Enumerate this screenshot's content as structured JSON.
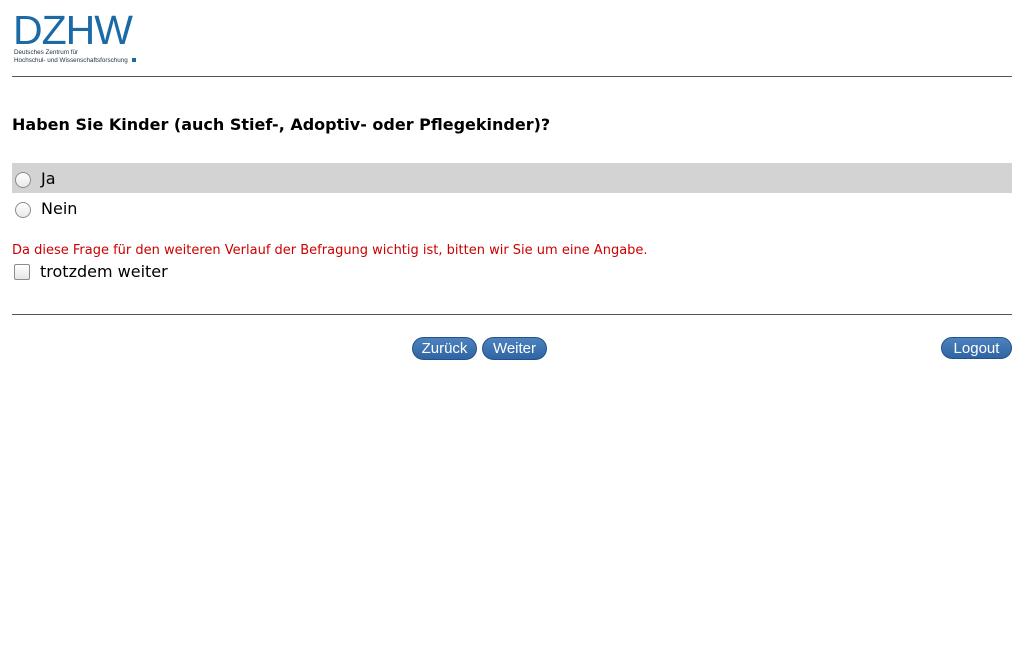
{
  "logo": {
    "mark": "DZHW",
    "line1": "Deutsches Zentrum für",
    "line2": "Hochschul- und Wissenschaftsforschung"
  },
  "question": "Haben Sie Kinder (auch Stief-, Adoptiv- oder Pflegekinder)?",
  "options": [
    {
      "label": "Ja",
      "selected": false
    },
    {
      "label": "Nein",
      "selected": false
    }
  ],
  "validation_message": "Da diese Frage für den weiteren Verlauf der Befragung wichtig ist, bitten wir Sie um eine Angabe.",
  "override_checkbox": {
    "label": "trotzdem weiter",
    "checked": false
  },
  "buttons": {
    "back": "Zurück",
    "next": "Weiter",
    "logout": "Logout"
  },
  "colors": {
    "accent": "#2f65a3",
    "error": "#cc0000",
    "highlight": "#d3d3d3",
    "logo": "#1a6aa6"
  }
}
